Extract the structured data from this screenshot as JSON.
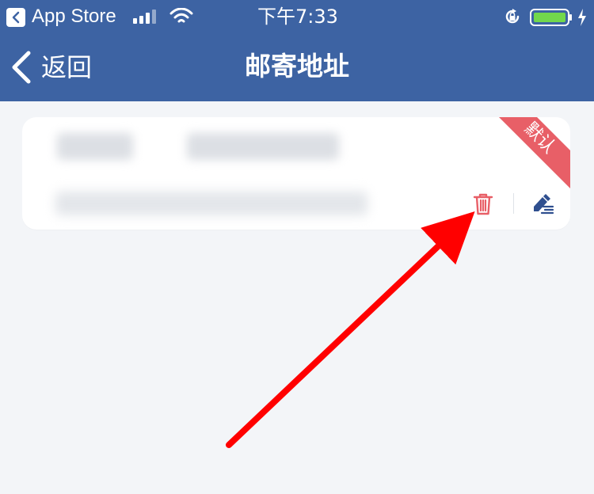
{
  "status_bar": {
    "back_app_label": "App Store",
    "time": "下午7:33"
  },
  "nav": {
    "back_label": "返回",
    "title": "邮寄地址"
  },
  "address_card": {
    "badge_label": "默认"
  },
  "colors": {
    "nav_background": "#3d63a3",
    "page_background": "#f3f5f8",
    "card_background": "#ffffff",
    "badge": "#e85f67",
    "delete_icon": "#e85f67",
    "edit_icon": "#2f4f8f",
    "annotation_arrow": "#ff0000"
  }
}
